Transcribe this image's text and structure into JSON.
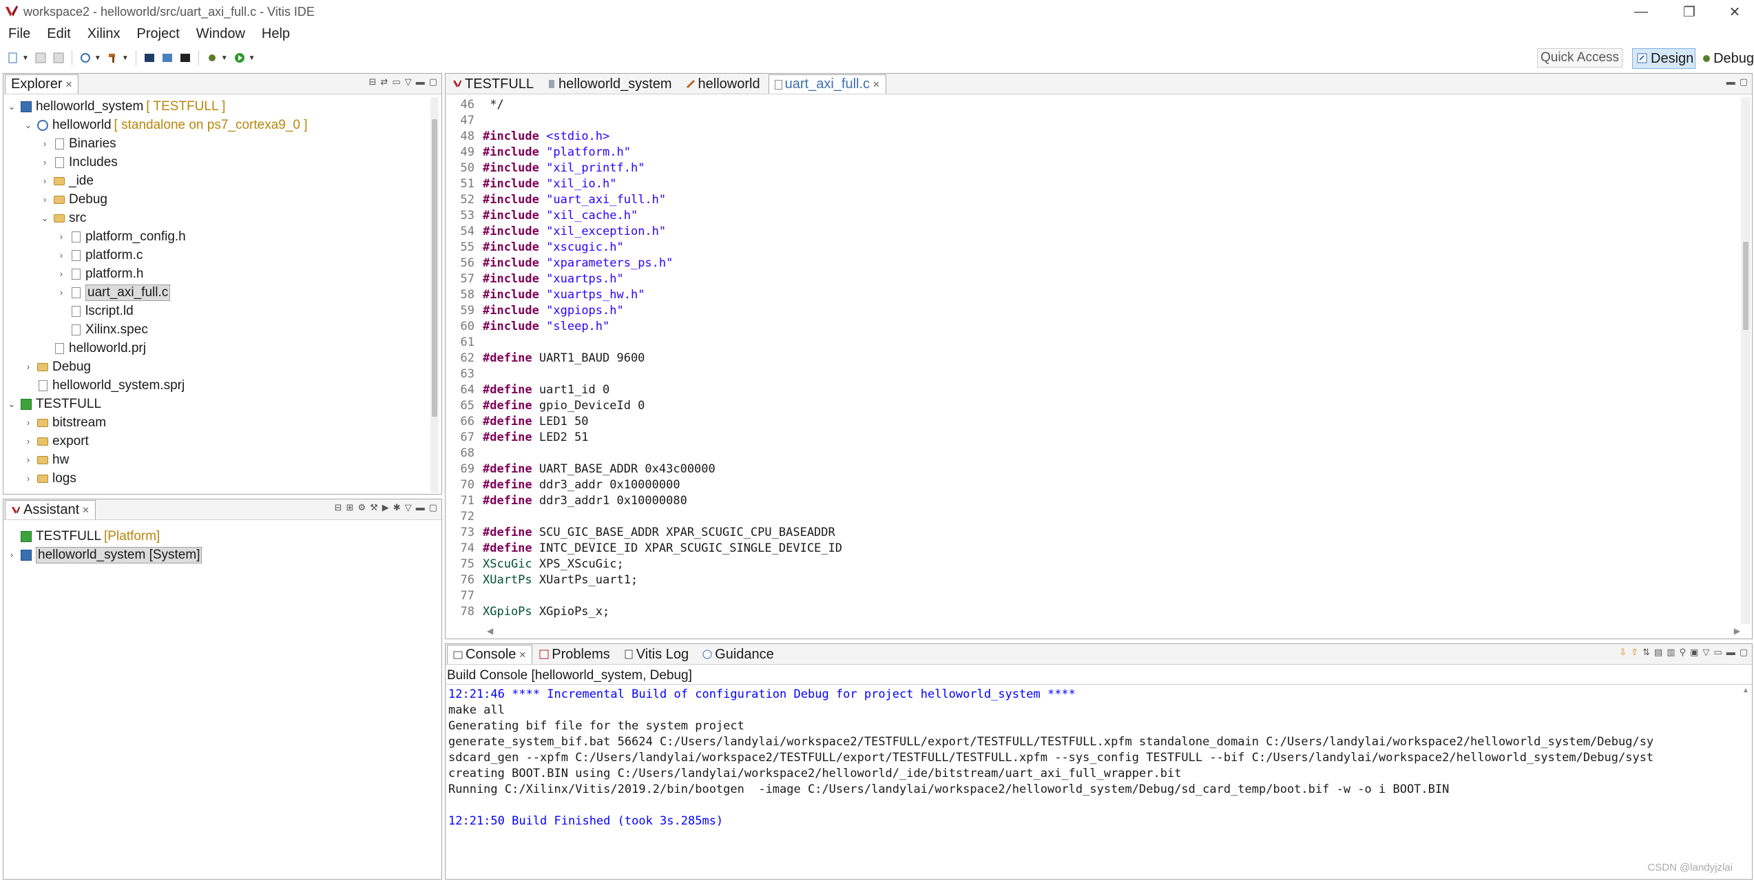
{
  "window": {
    "title": "workspace2 - helloworld/src/uart_axi_full.c - Vitis IDE",
    "minimize": "—",
    "maximize": "❐",
    "close": "✕"
  },
  "menu": [
    "File",
    "Edit",
    "Xilinx",
    "Project",
    "Window",
    "Help"
  ],
  "toolbar": {
    "quick_access": "Quick Access",
    "perspective_design": "Design",
    "perspective_debug": "Debug"
  },
  "explorer": {
    "tab_label": "Explorer",
    "items": [
      {
        "label": "helloworld_system",
        "decoration": "[ TESTFULL ]"
      },
      {
        "label": "helloworld",
        "decoration": "[ standalone on ps7_cortexa9_0 ]"
      },
      {
        "label": "Binaries"
      },
      {
        "label": "Includes"
      },
      {
        "label": "_ide"
      },
      {
        "label": "Debug"
      },
      {
        "label": "src"
      },
      {
        "label": "platform_config.h"
      },
      {
        "label": "platform.c"
      },
      {
        "label": "platform.h"
      },
      {
        "label": "uart_axi_full.c"
      },
      {
        "label": "lscript.ld"
      },
      {
        "label": "Xilinx.spec"
      },
      {
        "label": "helloworld.prj"
      },
      {
        "label": "Debug"
      },
      {
        "label": "helloworld_system.sprj"
      },
      {
        "label": "TESTFULL"
      },
      {
        "label": "bitstream"
      },
      {
        "label": "export"
      },
      {
        "label": "hw"
      },
      {
        "label": "logs"
      }
    ]
  },
  "assistant": {
    "tab_label": "Assistant",
    "items": [
      {
        "label": "TESTFULL",
        "decoration": "[Platform]"
      },
      {
        "label": "helloworld_system [System]"
      }
    ]
  },
  "editor": {
    "tabs": [
      "TESTFULL",
      "helloworld_system",
      "helloworld",
      "uart_axi_full.c"
    ],
    "lines": [
      {
        "n": "46",
        "segs": [
          {
            "t": " */",
            "c": ""
          }
        ]
      },
      {
        "n": "47",
        "segs": []
      },
      {
        "n": "48",
        "segs": [
          {
            "t": "#include",
            "c": "kw"
          },
          {
            "t": " ",
            "c": ""
          },
          {
            "t": "<stdio.h>",
            "c": "str"
          }
        ]
      },
      {
        "n": "49",
        "segs": [
          {
            "t": "#include",
            "c": "kw"
          },
          {
            "t": " ",
            "c": ""
          },
          {
            "t": "\"platform.h\"",
            "c": "str"
          }
        ]
      },
      {
        "n": "50",
        "segs": [
          {
            "t": "#include",
            "c": "kw"
          },
          {
            "t": " ",
            "c": ""
          },
          {
            "t": "\"xil_printf.h\"",
            "c": "str"
          }
        ]
      },
      {
        "n": "51",
        "segs": [
          {
            "t": "#include",
            "c": "kw"
          },
          {
            "t": " ",
            "c": ""
          },
          {
            "t": "\"xil_io.h\"",
            "c": "str"
          }
        ]
      },
      {
        "n": "52",
        "segs": [
          {
            "t": "#include",
            "c": "kw"
          },
          {
            "t": " ",
            "c": ""
          },
          {
            "t": "\"uart_axi_full.h\"",
            "c": "str"
          }
        ]
      },
      {
        "n": "53",
        "segs": [
          {
            "t": "#include",
            "c": "kw"
          },
          {
            "t": " ",
            "c": ""
          },
          {
            "t": "\"xil_cache.h\"",
            "c": "str"
          }
        ]
      },
      {
        "n": "54",
        "segs": [
          {
            "t": "#include",
            "c": "kw"
          },
          {
            "t": " ",
            "c": ""
          },
          {
            "t": "\"xil_exception.h\"",
            "c": "str"
          }
        ]
      },
      {
        "n": "55",
        "segs": [
          {
            "t": "#include",
            "c": "kw"
          },
          {
            "t": " ",
            "c": ""
          },
          {
            "t": "\"xscugic.h\"",
            "c": "str"
          }
        ]
      },
      {
        "n": "56",
        "segs": [
          {
            "t": "#include",
            "c": "kw"
          },
          {
            "t": " ",
            "c": ""
          },
          {
            "t": "\"xparameters_ps.h\"",
            "c": "str"
          }
        ]
      },
      {
        "n": "57",
        "segs": [
          {
            "t": "#include",
            "c": "kw"
          },
          {
            "t": " ",
            "c": ""
          },
          {
            "t": "\"xuartps.h\"",
            "c": "str"
          }
        ]
      },
      {
        "n": "58",
        "segs": [
          {
            "t": "#include",
            "c": "kw"
          },
          {
            "t": " ",
            "c": ""
          },
          {
            "t": "\"xuartps_hw.h\"",
            "c": "str"
          }
        ]
      },
      {
        "n": "59",
        "segs": [
          {
            "t": "#include",
            "c": "kw"
          },
          {
            "t": " ",
            "c": ""
          },
          {
            "t": "\"xgpiops.h\"",
            "c": "str"
          }
        ]
      },
      {
        "n": "60",
        "segs": [
          {
            "t": "#include",
            "c": "kw"
          },
          {
            "t": " ",
            "c": ""
          },
          {
            "t": "\"sleep.h\"",
            "c": "str"
          }
        ]
      },
      {
        "n": "61",
        "segs": []
      },
      {
        "n": "62",
        "segs": [
          {
            "t": "#define",
            "c": "kw"
          },
          {
            "t": " UART1_BAUD 9600",
            "c": ""
          }
        ]
      },
      {
        "n": "63",
        "segs": []
      },
      {
        "n": "64",
        "segs": [
          {
            "t": "#define",
            "c": "kw"
          },
          {
            "t": " uart1_id 0",
            "c": ""
          }
        ]
      },
      {
        "n": "65",
        "segs": [
          {
            "t": "#define",
            "c": "kw"
          },
          {
            "t": " gpio_DeviceId 0",
            "c": ""
          }
        ]
      },
      {
        "n": "66",
        "segs": [
          {
            "t": "#define",
            "c": "kw"
          },
          {
            "t": " LED1 50",
            "c": ""
          }
        ]
      },
      {
        "n": "67",
        "segs": [
          {
            "t": "#define",
            "c": "kw"
          },
          {
            "t": " LED2 51",
            "c": ""
          }
        ]
      },
      {
        "n": "68",
        "segs": []
      },
      {
        "n": "69",
        "segs": [
          {
            "t": "#define",
            "c": "kw"
          },
          {
            "t": " UART_BASE_ADDR 0x43c00000",
            "c": ""
          }
        ]
      },
      {
        "n": "70",
        "segs": [
          {
            "t": "#define",
            "c": "kw"
          },
          {
            "t": " ddr3_addr 0x10000000",
            "c": ""
          }
        ]
      },
      {
        "n": "71",
        "segs": [
          {
            "t": "#define",
            "c": "kw"
          },
          {
            "t": " ddr3_addr1 0x10000080",
            "c": ""
          }
        ]
      },
      {
        "n": "72",
        "segs": []
      },
      {
        "n": "73",
        "segs": [
          {
            "t": "#define",
            "c": "kw"
          },
          {
            "t": " SCU_GIC_BASE_ADDR XPAR_SCUGIC_CPU_BASEADDR",
            "c": ""
          }
        ]
      },
      {
        "n": "74",
        "segs": [
          {
            "t": "#define",
            "c": "kw"
          },
          {
            "t": " INTC_DEVICE_ID XPAR_SCUGIC_SINGLE_DEVICE_ID",
            "c": ""
          }
        ]
      },
      {
        "n": "75",
        "segs": [
          {
            "t": "XScuGic",
            "c": "type"
          },
          {
            "t": " XPS_XScuGic;",
            "c": ""
          }
        ]
      },
      {
        "n": "76",
        "segs": [
          {
            "t": "XUartPs",
            "c": "type"
          },
          {
            "t": " XUartPs_uart1;",
            "c": ""
          }
        ]
      },
      {
        "n": "77",
        "segs": []
      },
      {
        "n": "78",
        "segs": [
          {
            "t": "XGpioPs",
            "c": "type"
          },
          {
            "t": " XGpioPs_x;",
            "c": ""
          }
        ]
      }
    ]
  },
  "console": {
    "tabs": [
      "Console",
      "Problems",
      "Vitis Log",
      "Guidance"
    ],
    "title": "Build Console [helloworld_system, Debug]",
    "lines": [
      {
        "t": "12:21:46 **** Incremental Build of configuration Debug for project helloworld_system ****",
        "c": "blue"
      },
      {
        "t": "make all",
        "c": ""
      },
      {
        "t": "Generating bif file for the system project",
        "c": ""
      },
      {
        "t": "generate_system_bif.bat 56624 C:/Users/landylai/workspace2/TESTFULL/export/TESTFULL/TESTFULL.xpfm standalone_domain C:/Users/landylai/workspace2/helloworld_system/Debug/sy",
        "c": ""
      },
      {
        "t": "sdcard_gen --xpfm C:/Users/landylai/workspace2/TESTFULL/export/TESTFULL/TESTFULL.xpfm --sys_config TESTFULL --bif C:/Users/landylai/workspace2/helloworld_system/Debug/syst",
        "c": ""
      },
      {
        "t": "creating BOOT.BIN using C:/Users/landylai/workspace2/helloworld/_ide/bitstream/uart_axi_full_wrapper.bit",
        "c": ""
      },
      {
        "t": "Running C:/Xilinx/Vitis/2019.2/bin/bootgen  -image C:/Users/landylai/workspace2/helloworld_system/Debug/sd_card_temp/boot.bif -w -o i BOOT.BIN",
        "c": ""
      },
      {
        "t": "",
        "c": ""
      },
      {
        "t": "12:21:50 Build Finished (took 3s.285ms)",
        "c": "blue"
      }
    ]
  },
  "watermark": "CSDN @landyjzlai"
}
